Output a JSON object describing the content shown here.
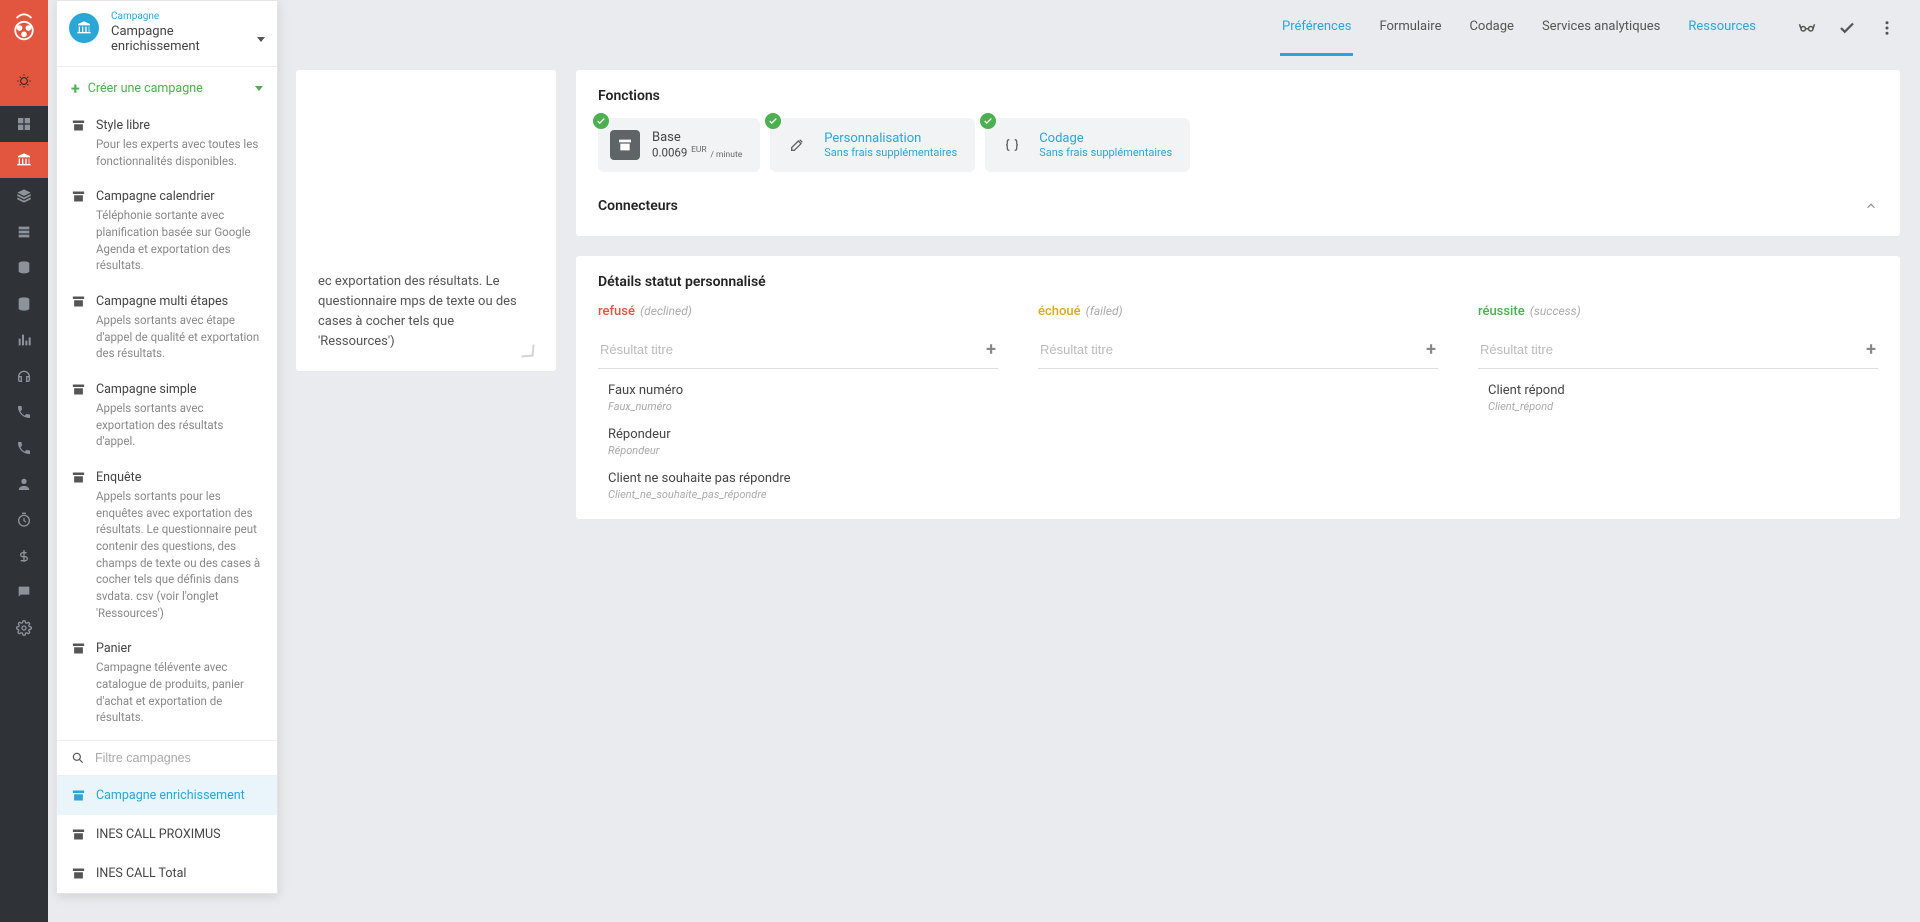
{
  "header": {
    "breadcrumb_small": "Campagne",
    "breadcrumb_big": "Campagne enrichissement"
  },
  "create": {
    "label": "Créer une campagne"
  },
  "campaign_types": [
    {
      "title": "Style libre",
      "desc": "Pour les experts avec toutes les fonctionnalités disponibles."
    },
    {
      "title": "Campagne calendrier",
      "desc": "Téléphonie sortante avec planification basée sur Google Agenda et exportation des résultats."
    },
    {
      "title": "Campagne multi étapes",
      "desc": "Appels sortants avec étape d'appel de qualité et exportation des résultats."
    },
    {
      "title": "Campagne simple",
      "desc": "Appels sortants avec exportation des résultats d'appel."
    },
    {
      "title": "Enquête",
      "desc": "Appels sortants pour les enquêtes avec exportation des résultats. Le questionnaire peut contenir des questions, des champs de texte ou des cases à cocher tels que définis dans svdata. csv (voir l'onglet 'Ressources')"
    },
    {
      "title": "Panier",
      "desc": "Campagne télévente avec catalogue de produits, panier d'achat et exportation de résultats."
    }
  ],
  "search": {
    "placeholder": "Filtre campagnes"
  },
  "campaign_list": [
    {
      "label": "Campagne enrichissement",
      "active": true
    },
    {
      "label": "INES CALL PROXIMUS",
      "active": false
    },
    {
      "label": "INES CALL Total",
      "active": false
    }
  ],
  "tabs": [
    {
      "label": "Préférences",
      "state": "active"
    },
    {
      "label": "Formulaire",
      "state": "normal"
    },
    {
      "label": "Codage",
      "state": "normal"
    },
    {
      "label": "Services analytiques",
      "state": "normal"
    },
    {
      "label": "Ressources",
      "state": "link"
    }
  ],
  "left_card": {
    "desc": "ec exportation des résultats. Le questionnaire mps de texte ou des cases à cocher tels que 'Ressources')"
  },
  "fonctions": {
    "title": "Fonctions",
    "pills": [
      {
        "title": "Base",
        "price_val": "0.0069",
        "price_cur": "EUR",
        "price_unit": "/ minute"
      },
      {
        "title": "Personnalisation",
        "sub": "Sans frais supplémentaires"
      },
      {
        "title": "Codage",
        "sub": "Sans frais supplémentaires"
      }
    ],
    "connecteurs_label": "Connecteurs"
  },
  "details": {
    "title": "Détails statut personnalisé",
    "placeholder": "Résultat titre",
    "columns": [
      {
        "key": "refuse",
        "main": "refusé",
        "sub": "(declined)",
        "color": "red",
        "items": [
          {
            "label": "Faux numéro",
            "slug": "Faux_numéro"
          },
          {
            "label": "Répondeur",
            "slug": "Répondeur"
          },
          {
            "label": "Client ne souhaite pas répondre",
            "slug": "Client_ne_souhaite_pas_répondre"
          }
        ]
      },
      {
        "key": "echoue",
        "main": "échoué",
        "sub": "(failed)",
        "color": "yellow",
        "items": []
      },
      {
        "key": "reussite",
        "main": "réussite",
        "sub": "(success)",
        "color": "green",
        "items": [
          {
            "label": "Client répond",
            "slug": "Client_répond"
          }
        ]
      }
    ]
  }
}
